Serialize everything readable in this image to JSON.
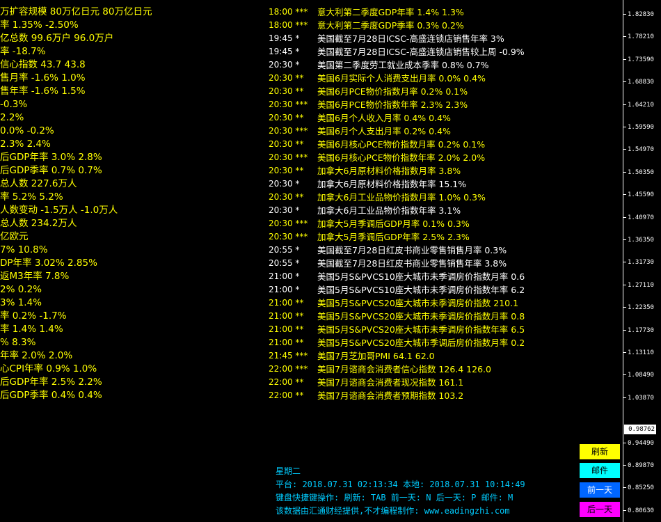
{
  "left_items": [
    "万扩容规模 80万亿日元 80万亿日元",
    "率 1.35% -2.50%",
    "亿总数 99.6万户 96.0万户",
    "率 -18.7%",
    "信心指数 43.7 43.8",
    "售月率 -1.6% 1.0%",
    "售年率 -1.6% 1.5%",
    "-0.3%",
    "2.2%",
    "0.0% -0.2%",
    "2.3% 2.4%",
    "后GDP年率 3.0% 2.8%",
    "后GDP季率 0.7% 0.7%",
    "总人数 227.6万人",
    "率 5.2% 5.2%",
    "人数变动 -1.5万人 -1.0万人",
    "总人数 234.2万人",
    "亿欧元",
    "7% 10.8%",
    "DP年率 3.02% 2.85%",
    "返M3年率 7.8%",
    "2% 0.2%",
    "3% 1.4%",
    "率 0.2% -1.7%",
    "率 1.4% 1.4%",
    "% 8.3%",
    "年率 2.0% 2.0%",
    "心CPI年率 0.9% 1.0%",
    "后GDP年率 2.5% 2.2%",
    "后GDP季率 0.4% 0.4%"
  ],
  "events": [
    {
      "time": "18:00 ***",
      "text": "意大利第二季度GDP年率 1.4% 1.3%",
      "color": "yellow"
    },
    {
      "time": "18:00 ***",
      "text": "意大利第二季度GDP季率 0.3% 0.2%",
      "color": "yellow"
    },
    {
      "time": "19:45 *",
      "text": "美国截至7月28日ICSC-高盛连锁店销售年率 3%",
      "color": "white"
    },
    {
      "time": "19:45 *",
      "text": "美国截至7月28日ICSC-高盛连锁店销售较上周 -0.9%",
      "color": "white"
    },
    {
      "time": "20:30 *",
      "text": "美国第二季度劳工就业成本季率 0.8% 0.7%",
      "color": "white"
    },
    {
      "time": "20:30 **",
      "text": "美国6月实际个人消费支出月率 0.0% 0.4%",
      "color": "yellow"
    },
    {
      "time": "20:30 **",
      "text": "美国6月PCE物价指数月率 0.2% 0.1%",
      "color": "yellow"
    },
    {
      "time": "20:30 ***",
      "text": "美国6月PCE物价指数年率 2.3% 2.3%",
      "color": "yellow"
    },
    {
      "time": "20:30 **",
      "text": "美国6月个人收入月率 0.4% 0.4%",
      "color": "yellow"
    },
    {
      "time": "20:30 ***",
      "text": "美国6月个人支出月率 0.2% 0.4%",
      "color": "yellow"
    },
    {
      "time": "20:30 **",
      "text": "美国6月核心PCE物价指数月率 0.2% 0.1%",
      "color": "yellow"
    },
    {
      "time": "20:30 ***",
      "text": "美国6月核心PCE物价指数年率 2.0% 2.0%",
      "color": "yellow"
    },
    {
      "time": "20:30 **",
      "text": "加拿大6月原材料价格指数月率 3.8%",
      "color": "yellow"
    },
    {
      "time": "20:30 *",
      "text": "加拿大6月原材料价格指数年率 15.1%",
      "color": "white"
    },
    {
      "time": "20:30 **",
      "text": "加拿大6月工业品物价指数月率 1.0% 0.3%",
      "color": "yellow"
    },
    {
      "time": "20:30 *",
      "text": "加拿大6月工业品物价指数年率 3.1%",
      "color": "white"
    },
    {
      "time": "20:30 ***",
      "text": "加拿大5月季调后GDP月率 0.1% 0.3%",
      "color": "yellow"
    },
    {
      "time": "20:30 ***",
      "text": "加拿大5月季调后GDP年率 2.5% 2.3%",
      "color": "yellow"
    },
    {
      "time": "20:55 *",
      "text": "美国截至7月28日红皮书商业零售销售月率 0.3%",
      "color": "white"
    },
    {
      "time": "20:55 *",
      "text": "美国截至7月28日红皮书商业零售销售年率 3.8%",
      "color": "white"
    },
    {
      "time": "21:00 *",
      "text": "美国5月S&PVCS10座大城市未季调房价指数月率 0.6",
      "color": "white"
    },
    {
      "time": "21:00 *",
      "text": "美国5月S&PVCS10座大城市未季调房价指数年率 6.2",
      "color": "white"
    },
    {
      "time": "21:00 **",
      "text": "美国5月S&PVCS20座大城市未季调房价指数 210.1",
      "color": "yellow"
    },
    {
      "time": "21:00 **",
      "text": "美国5月S&PVCS20座大城市未季调房价指数月率 0.8",
      "color": "yellow"
    },
    {
      "time": "21:00 **",
      "text": "美国5月S&PVCS20座大城市未季调房价指数年率 6.5",
      "color": "yellow"
    },
    {
      "time": "21:00 **",
      "text": "美国5月S&PVCS20座大城市季调后房价指数月率 0.2",
      "color": "yellow"
    },
    {
      "time": "21:45 ***",
      "text": "美国7月芝加哥PMI 64.1 62.0",
      "color": "yellow"
    },
    {
      "time": "22:00 ***",
      "text": "美国7月谘商会消费者信心指数 126.4 126.0",
      "color": "yellow"
    },
    {
      "time": "22:00 **",
      "text": "美国7月谘商会消费者现况指数 161.1",
      "color": "yellow"
    },
    {
      "time": "22:00 **",
      "text": "美国7月谘商会消费者预期指数 103.2",
      "color": "yellow"
    }
  ],
  "price_axis": {
    "ticks": [
      "1.82830",
      "1.78210",
      "1.73590",
      "1.68830",
      "1.64210",
      "1.59590",
      "1.54970",
      "1.50350",
      "1.45590",
      "1.40970",
      "1.36350",
      "1.31730",
      "1.27110",
      "1.22350",
      "1.17730",
      "1.13110",
      "1.08490",
      "1.03870",
      "0.94490",
      "0.89870",
      "0.85250",
      "0.80630"
    ],
    "current": "0.98762"
  },
  "info": {
    "weekday": "星期二",
    "platform_line": "平台: 2018.07.31 02:13:34  本地: 2018.07.31 10:14:49",
    "shortcuts_line": "键盘快捷键操作: 刷新: TAB   前一天: N     后一天: P     邮件: M",
    "credit_line": "该数据由汇通财经提供,不才编程制作: www.eadingzhi.com"
  },
  "buttons": {
    "refresh": "刷新",
    "mail": "邮件",
    "prev": "前一天",
    "next": "后一天"
  },
  "colors": {
    "background": "#000000",
    "high_importance": "#ffff00",
    "low_importance": "#ffffff",
    "info_text": "#00ccff"
  }
}
